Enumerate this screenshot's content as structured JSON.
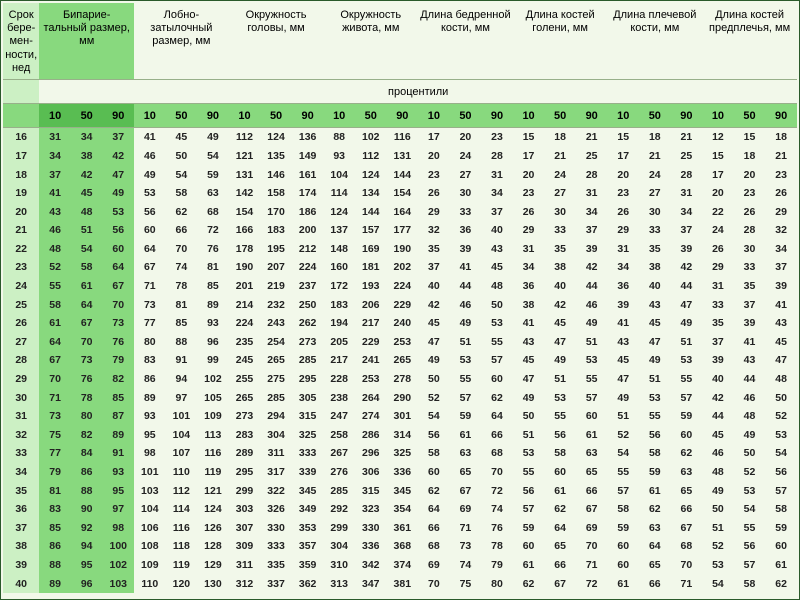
{
  "headers": {
    "week": "Срок бере-мен-ности, нед",
    "groups": [
      "Бипарие-тальный размер, мм",
      "Лобно-затылочный размер, мм",
      "Окружность головы, мм",
      "Окружность живота, мм",
      "Длина бедренной кости, мм",
      "Длина костей голени, мм",
      "Длина плечевой кости, мм",
      "Длина костей предплечья, мм"
    ],
    "percentiles_label": "процентили",
    "percentiles": [
      "10",
      "50",
      "90"
    ]
  },
  "rows": [
    {
      "w": "16",
      "v": [
        31,
        34,
        37,
        41,
        45,
        49,
        112,
        124,
        136,
        88,
        102,
        116,
        17,
        20,
        23,
        15,
        18,
        21,
        15,
        18,
        21,
        12,
        15,
        18
      ]
    },
    {
      "w": "17",
      "v": [
        34,
        38,
        42,
        46,
        50,
        54,
        121,
        135,
        149,
        93,
        112,
        131,
        20,
        24,
        28,
        17,
        21,
        25,
        17,
        21,
        25,
        15,
        18,
        21
      ]
    },
    {
      "w": "18",
      "v": [
        37,
        42,
        47,
        49,
        54,
        59,
        131,
        146,
        161,
        104,
        124,
        144,
        23,
        27,
        31,
        20,
        24,
        28,
        20,
        24,
        28,
        17,
        20,
        23
      ]
    },
    {
      "w": "19",
      "v": [
        41,
        45,
        49,
        53,
        58,
        63,
        142,
        158,
        174,
        114,
        134,
        154,
        26,
        30,
        34,
        23,
        27,
        31,
        23,
        27,
        31,
        20,
        23,
        26
      ]
    },
    {
      "w": "20",
      "v": [
        43,
        48,
        53,
        56,
        62,
        68,
        154,
        170,
        186,
        124,
        144,
        164,
        29,
        33,
        37,
        26,
        30,
        34,
        26,
        30,
        34,
        22,
        26,
        29
      ]
    },
    {
      "w": "21",
      "v": [
        46,
        51,
        56,
        60,
        66,
        72,
        166,
        183,
        200,
        137,
        157,
        177,
        32,
        36,
        40,
        29,
        33,
        37,
        29,
        33,
        37,
        24,
        28,
        32
      ]
    },
    {
      "w": "22",
      "v": [
        48,
        54,
        60,
        64,
        70,
        76,
        178,
        195,
        212,
        148,
        169,
        190,
        35,
        39,
        43,
        31,
        35,
        39,
        31,
        35,
        39,
        26,
        30,
        34
      ]
    },
    {
      "w": "23",
      "v": [
        52,
        58,
        64,
        67,
        74,
        81,
        190,
        207,
        224,
        160,
        181,
        202,
        37,
        41,
        45,
        34,
        38,
        42,
        34,
        38,
        42,
        29,
        33,
        37
      ]
    },
    {
      "w": "24",
      "v": [
        55,
        61,
        67,
        71,
        78,
        85,
        201,
        219,
        237,
        172,
        193,
        224,
        40,
        44,
        48,
        36,
        40,
        44,
        36,
        40,
        44,
        31,
        35,
        39
      ]
    },
    {
      "w": "25",
      "v": [
        58,
        64,
        70,
        73,
        81,
        89,
        214,
        232,
        250,
        183,
        206,
        229,
        42,
        46,
        50,
        38,
        42,
        46,
        39,
        43,
        47,
        33,
        37,
        41
      ]
    },
    {
      "w": "26",
      "v": [
        61,
        67,
        73,
        77,
        85,
        93,
        224,
        243,
        262,
        194,
        217,
        240,
        45,
        49,
        53,
        41,
        45,
        49,
        41,
        45,
        49,
        35,
        39,
        43
      ]
    },
    {
      "w": "27",
      "v": [
        64,
        70,
        76,
        80,
        88,
        96,
        235,
        254,
        273,
        205,
        229,
        253,
        47,
        51,
        55,
        43,
        47,
        51,
        43,
        47,
        51,
        37,
        41,
        45
      ]
    },
    {
      "w": "28",
      "v": [
        67,
        73,
        79,
        83,
        91,
        99,
        245,
        265,
        285,
        217,
        241,
        265,
        49,
        53,
        57,
        45,
        49,
        53,
        45,
        49,
        53,
        39,
        43,
        47
      ]
    },
    {
      "w": "29",
      "v": [
        70,
        76,
        82,
        86,
        94,
        102,
        255,
        275,
        295,
        228,
        253,
        278,
        50,
        55,
        60,
        47,
        51,
        55,
        47,
        51,
        55,
        40,
        44,
        48
      ]
    },
    {
      "w": "30",
      "v": [
        71,
        78,
        85,
        89,
        97,
        105,
        265,
        285,
        305,
        238,
        264,
        290,
        52,
        57,
        62,
        49,
        53,
        57,
        49,
        53,
        57,
        42,
        46,
        50
      ]
    },
    {
      "w": "31",
      "v": [
        73,
        80,
        87,
        93,
        101,
        109,
        273,
        294,
        315,
        247,
        274,
        301,
        54,
        59,
        64,
        50,
        55,
        60,
        51,
        55,
        59,
        44,
        48,
        52
      ]
    },
    {
      "w": "32",
      "v": [
        75,
        82,
        89,
        95,
        104,
        113,
        283,
        304,
        325,
        258,
        286,
        314,
        56,
        61,
        66,
        51,
        56,
        61,
        52,
        56,
        60,
        45,
        49,
        53
      ]
    },
    {
      "w": "33",
      "v": [
        77,
        84,
        91,
        98,
        107,
        116,
        289,
        311,
        333,
        267,
        296,
        325,
        58,
        63,
        68,
        53,
        58,
        63,
        54,
        58,
        62,
        46,
        50,
        54
      ]
    },
    {
      "w": "34",
      "v": [
        79,
        86,
        93,
        101,
        110,
        119,
        295,
        317,
        339,
        276,
        306,
        336,
        60,
        65,
        70,
        55,
        60,
        65,
        55,
        59,
        63,
        48,
        52,
        56
      ]
    },
    {
      "w": "35",
      "v": [
        81,
        88,
        95,
        103,
        112,
        121,
        299,
        322,
        345,
        285,
        315,
        345,
        62,
        67,
        72,
        56,
        61,
        66,
        57,
        61,
        65,
        49,
        53,
        57
      ]
    },
    {
      "w": "36",
      "v": [
        83,
        90,
        97,
        104,
        114,
        124,
        303,
        326,
        349,
        292,
        323,
        354,
        64,
        69,
        74,
        57,
        62,
        67,
        58,
        62,
        66,
        50,
        54,
        58
      ]
    },
    {
      "w": "37",
      "v": [
        85,
        92,
        98,
        106,
        116,
        126,
        307,
        330,
        353,
        299,
        330,
        361,
        66,
        71,
        76,
        59,
        64,
        69,
        59,
        63,
        67,
        51,
        55,
        59
      ]
    },
    {
      "w": "38",
      "v": [
        86,
        94,
        100,
        108,
        118,
        128,
        309,
        333,
        357,
        304,
        336,
        368,
        68,
        73,
        78,
        60,
        65,
        70,
        60,
        64,
        68,
        52,
        56,
        60
      ]
    },
    {
      "w": "39",
      "v": [
        88,
        95,
        102,
        109,
        119,
        129,
        311,
        335,
        359,
        310,
        342,
        374,
        69,
        74,
        79,
        61,
        66,
        71,
        60,
        65,
        70,
        53,
        57,
        61
      ]
    },
    {
      "w": "40",
      "v": [
        89,
        96,
        103,
        110,
        120,
        130,
        312,
        337,
        362,
        313,
        347,
        381,
        70,
        75,
        80,
        62,
        67,
        72,
        61,
        66,
        71,
        54,
        58,
        62
      ]
    }
  ]
}
